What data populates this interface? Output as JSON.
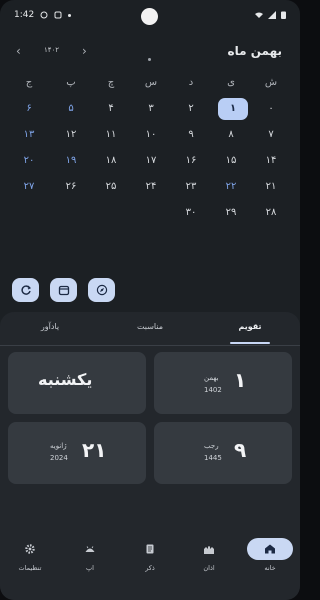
{
  "status": {
    "time": "1:42",
    "wifi_icon": "wifi-icon",
    "battery_icon": "battery-icon"
  },
  "header": {
    "month": "بهمن ماه",
    "year": "۱۴۰۲"
  },
  "calendar": {
    "rows": [
      [
        "ش",
        "ی",
        "د",
        "س",
        "چ",
        "پ",
        "ج"
      ],
      [
        "۱",
        "",
        "",
        "",
        "",
        "",
        ""
      ],
      [
        "۲",
        "۳",
        "۴",
        "۵",
        "۶",
        "۷",
        "۸"
      ],
      [
        "۹",
        "۱۰",
        "۱۱",
        "۱۲",
        "۱۳",
        "۱۴",
        "۱۵"
      ],
      [
        "۱۶",
        "۱۷",
        "۱۸",
        "۱۹",
        "۲۰",
        "۲۱",
        "۲۲"
      ],
      [
        "۲۳",
        "۲۴",
        "۲۵",
        "۲۶",
        "۲۷",
        "۲۸",
        "۲۹"
      ],
      [
        "۳۰"
      ]
    ]
  },
  "grid_labels": {
    "r0": [
      "ش",
      "ی",
      "د",
      "س",
      "چ",
      "پ",
      "ج"
    ],
    "r1": [
      "۶",
      "۵",
      "۴",
      "۳",
      "۲",
      "۱",
      "۰"
    ],
    "r2": [
      "۱۳",
      "۱۲",
      "۱۱",
      "۱۰",
      "۹",
      "۸",
      "۷"
    ],
    "r3": [
      "۲۰",
      "۱۹",
      "۱۸",
      "۱۷",
      "۱۶",
      "۱۵",
      "۱۴"
    ],
    "r4": [
      "۲۷",
      "۲۶",
      "۲۵",
      "۲۴",
      "۲۳",
      "۲۲",
      "۲۱"
    ],
    "r5": [
      "۳۰",
      "۲۹",
      "۲۸"
    ]
  },
  "tabs": {
    "calendar": "تقویم",
    "occasions": "مناسبت",
    "notes": "یادآور"
  },
  "cards": {
    "weekday": "یکشنبه",
    "jalali": {
      "day": "۱",
      "month": "بهمن",
      "year": "1402"
    },
    "gregorian": {
      "day": "۲۱",
      "month": "ژانویه",
      "year": "2024"
    },
    "hijri": {
      "day": "۹",
      "month": "رجب",
      "year": "1445"
    }
  },
  "nav": {
    "home": "خانه",
    "azan": "اذان",
    "zekr": "ذکر",
    "app": "اپ",
    "settings": "تنظیمات"
  },
  "colors": {
    "accent": "#c9d8f3",
    "today_bg": "#b9cef5",
    "holiday": "#7fa4e8"
  }
}
